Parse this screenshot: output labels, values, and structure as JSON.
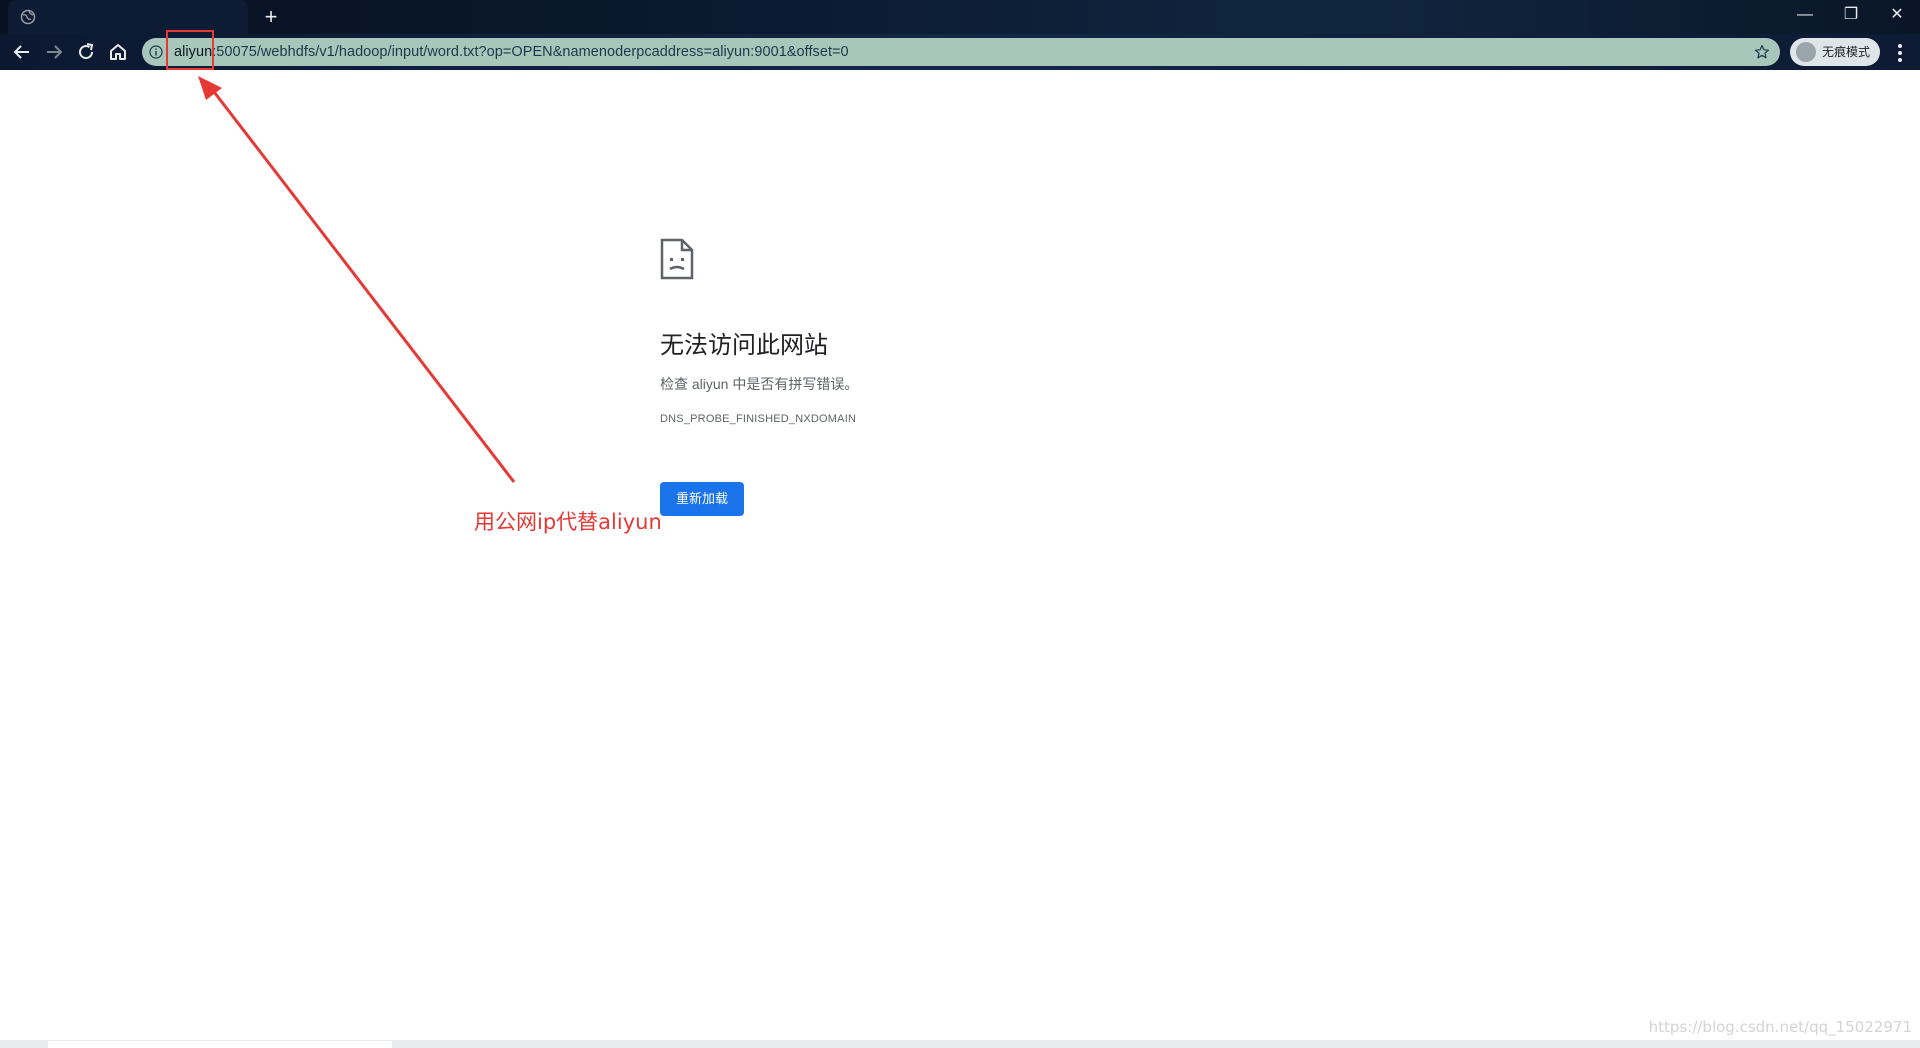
{
  "browser": {
    "address_host": "aliyun",
    "address_rest": ":50075/webhdfs/v1/hadoop/input/word.txt?op=OPEN&namenoderpcaddress=aliyun:9001&offset=0",
    "incognito_label": "无痕模式",
    "new_tab_glyph": "+",
    "minimize_glyph": "—",
    "restore_glyph": "❐",
    "close_glyph": "✕"
  },
  "error_page": {
    "title": "无法访问此网站",
    "description": "检查 aliyun 中是否有拼写错误。",
    "error_code": "DNS_PROBE_FINISHED_NXDOMAIN",
    "reload_label": "重新加载"
  },
  "annotation": {
    "text": "用公网ip代替aliyun",
    "color": "#e53935"
  },
  "watermark": "https://blog.csdn.net/qq_15022971",
  "colors": {
    "omnibox_bg": "#a9c6bb",
    "reload_button": "#1a73e8"
  }
}
